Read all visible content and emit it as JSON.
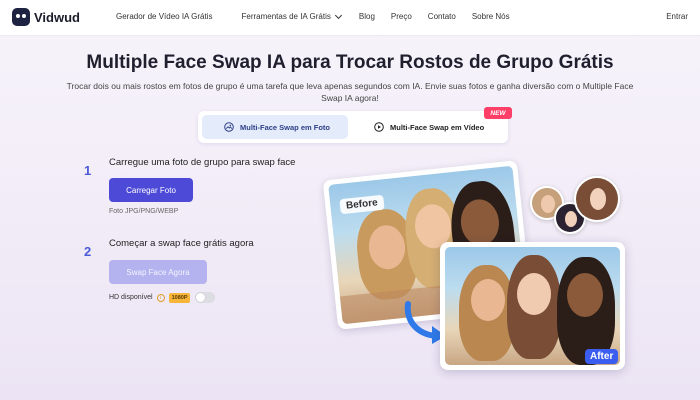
{
  "nav": {
    "logo": "Vidwud",
    "links": [
      "Gerador de Vídeo IA Grátis",
      "Ferramentas de IA Grátis",
      "Blog",
      "Preço",
      "Contato",
      "Sobre Nós"
    ],
    "login": "Entrar"
  },
  "hero": {
    "title": "Multiple Face Swap IA para Trocar Rostos de Grupo Grátis",
    "subtitle": "Trocar dois ou mais rostos em fotos de grupo é uma tarefa que leva apenas segundos com IA. Envie suas fotos e ganha diversão com o Multiple Face Swap IA agora!"
  },
  "tabs": {
    "photo": "Multi-Face Swap em Foto",
    "video": "Multi-Face Swap em Vídeo",
    "badge": "NEW"
  },
  "steps": {
    "one": {
      "number": "1",
      "title": "Carregue uma foto de grupo para swap face",
      "button": "Carregar Foto",
      "formats": "Foto JPG/PNG/WEBP"
    },
    "two": {
      "number": "2",
      "title": "Começar a swap face grátis agora",
      "button": "Swap Face Agora",
      "hd_label": "HD disponível",
      "hd_badge": "1080P"
    }
  },
  "images": {
    "before_label": "Before",
    "after_label": "After"
  },
  "colors": {
    "primary": "#4d4ad8",
    "primary_disabled": "#b4b2ef",
    "step_number": "#4b5bd6",
    "badge_new": "#ff3f68",
    "after_label": "#3c5ef0"
  }
}
